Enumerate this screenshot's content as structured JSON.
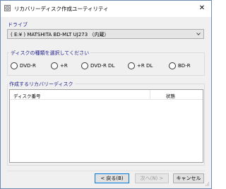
{
  "window": {
    "title": "リカバリーディスク作成ユーティリティ",
    "close_symbol": "✕"
  },
  "drive": {
    "section_label": "ドライブ",
    "selected": "( E:¥ ) MATSHITA BD-MLT UJ273    （内蔵）"
  },
  "disc_type": {
    "group_title": "ディスクの種類を選択してください",
    "options": [
      "DVD-R",
      "+R",
      "DVD-R DL",
      "+R DL",
      "BD-R"
    ]
  },
  "recovery_list": {
    "group_title": "作成するリカバリーディスク",
    "columns": [
      "ディスク番号",
      "状態"
    ],
    "rows": []
  },
  "buttons": {
    "back": "< 戻る(B)",
    "next": "次へ(N) >",
    "cancel": "キャンセル"
  },
  "colors": {
    "label_text": "#1e1e8c",
    "window_bg": "#f0f0f0",
    "focus_border": "#0078d7"
  }
}
